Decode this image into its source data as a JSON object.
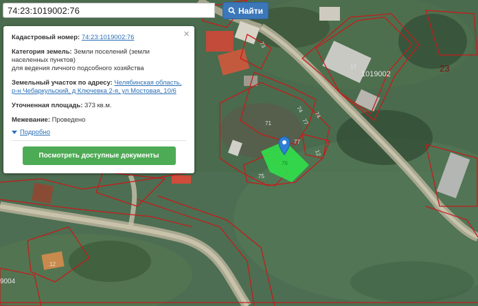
{
  "search": {
    "value": "74:23:1019002:76",
    "button_label": "Найти",
    "icon": "search-icon"
  },
  "info_panel": {
    "cadastral_label": "Кадастровый номер:",
    "cadastral_value": "74:23:1019002:76",
    "category_label": "Категория земель:",
    "category_value_line1": "Земли поселений (земли",
    "category_value_line2": "населенных пунктов)",
    "category_value_line3": "для ведения личного подсобного хозяйства",
    "address_label": "Земельный участок по адресу:",
    "address_line1": "Челябинская область,",
    "address_line2": "р-н Чебаркульский, д Ключевка 2-я, ул Мостовая, 10/6",
    "area_label": "Уточненная площадь:",
    "area_value": "373 кв.м.",
    "survey_label": "Межевание:",
    "survey_value": "Проведено",
    "details_label": "Подробно",
    "docs_button_label": "Посмотреть доступные документы",
    "close_icon": "×"
  },
  "map": {
    "parcel_labels": [
      "73",
      "71",
      "74",
      "74",
      "77",
      "77",
      "75",
      "17",
      "12",
      "12"
    ],
    "block_label": "1019002",
    "quarter_label": "23",
    "edge_label": "9004",
    "selected_label": "76",
    "colors": {
      "boundary": "#c61b1b",
      "selected_parcel": "#2ee84a",
      "marker": "#2f7fd6"
    }
  }
}
